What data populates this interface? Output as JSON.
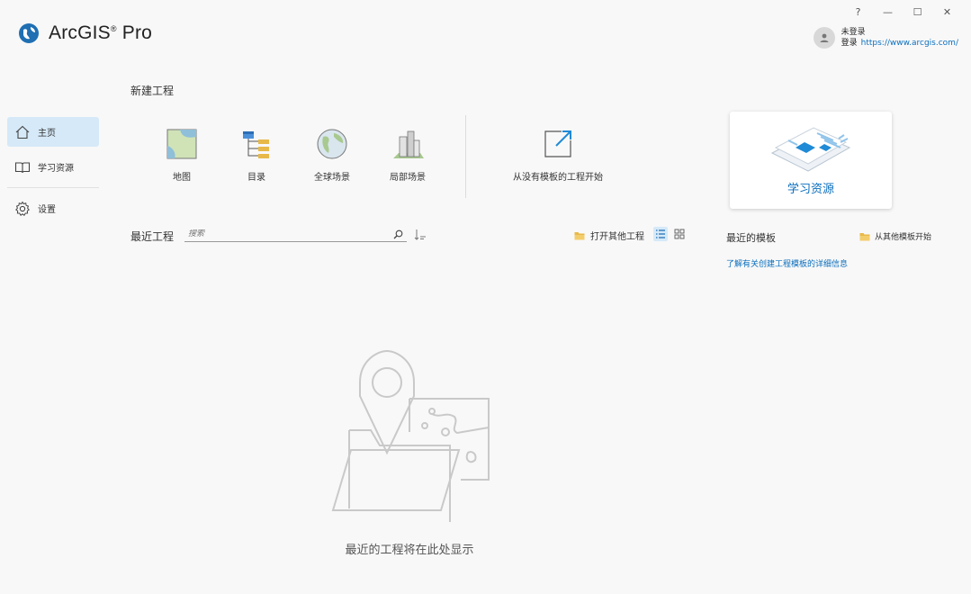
{
  "window": {
    "controls": [
      "?",
      "—",
      "☐",
      "✕"
    ]
  },
  "app": {
    "title": "ArcGIS",
    "title_mark": "®",
    "title_suffix": "Pro"
  },
  "user": {
    "name": "未登录",
    "login": "登录",
    "portal": "https://www.arcgis.com/"
  },
  "sidebar": {
    "items": [
      {
        "label": "主页",
        "icon": "home-icon",
        "active": true
      },
      {
        "label": "学习资源",
        "icon": "book-icon",
        "active": false
      },
      {
        "label": "设置",
        "icon": "gear-icon",
        "active": false
      }
    ]
  },
  "new_project": {
    "title": "新建工程",
    "tiles": [
      {
        "label": "地图",
        "icon": "map-icon"
      },
      {
        "label": "目录",
        "icon": "catalog-icon"
      },
      {
        "label": "全球场景",
        "icon": "globe-scene-icon"
      },
      {
        "label": "局部场景",
        "icon": "local-scene-icon"
      },
      {
        "label": "从没有模板的工程开始",
        "icon": "start-without-template-icon"
      }
    ],
    "learn_card": {
      "label": "学习资源"
    }
  },
  "recent": {
    "title": "最近工程",
    "search_placeholder": "搜索",
    "open_other": "打开其他工程",
    "empty_message": "最近的工程将在此处显示"
  },
  "templates": {
    "title": "最近的模板",
    "from_template": "从其他模板开始",
    "learn_link": "了解有关创建工程模板的详细信息"
  },
  "colors": {
    "accent": "#0a6ebd",
    "active_bg": "#d5e9f8",
    "folder": "#e8b949"
  }
}
